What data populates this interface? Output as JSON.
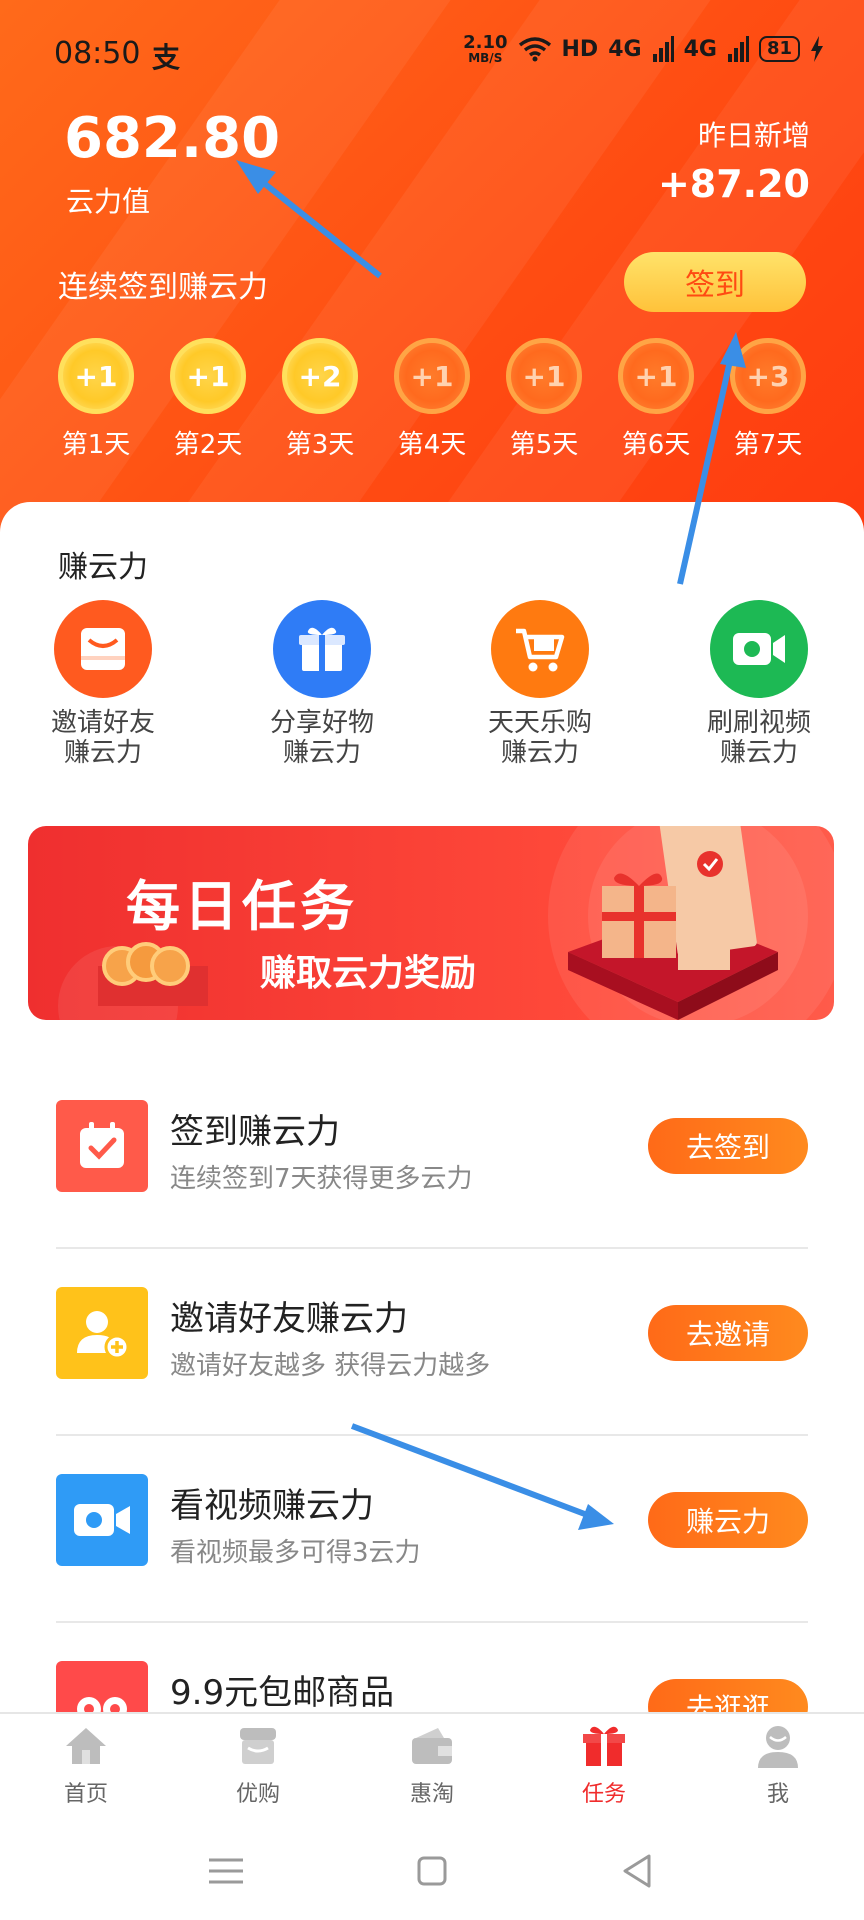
{
  "status": {
    "time": "08:50",
    "app_glyph": "支",
    "net_speed": "2.10",
    "net_unit": "MB/S",
    "hd": "HD",
    "sig1": "4G",
    "sig2": "4G",
    "battery": "81"
  },
  "header": {
    "score_value": "682.80",
    "score_label": "云力值",
    "yesterday_label": "昨日新增",
    "yesterday_value": "+87.20",
    "checkin_title": "连续签到赚云力",
    "checkin_button": "签到",
    "days": [
      {
        "reward": "+1",
        "label": "第1天",
        "done": true
      },
      {
        "reward": "+1",
        "label": "第2天",
        "done": true
      },
      {
        "reward": "+2",
        "label": "第3天",
        "done": true
      },
      {
        "reward": "+1",
        "label": "第4天",
        "done": false
      },
      {
        "reward": "+1",
        "label": "第5天",
        "done": false
      },
      {
        "reward": "+1",
        "label": "第6天",
        "done": false
      },
      {
        "reward": "+3",
        "label": "第7天",
        "done": false
      }
    ]
  },
  "earn": {
    "title": "赚云力",
    "items": [
      {
        "line1": "邀请好友",
        "line2": "赚云力",
        "icon": "invite-icon",
        "color": "#ff5a1f"
      },
      {
        "line1": "分享好物",
        "line2": "赚云力",
        "icon": "gift-icon",
        "color": "#2f7cf6"
      },
      {
        "line1": "天天乐购",
        "line2": "赚云力",
        "icon": "cart-icon",
        "color": "#ff7a10"
      },
      {
        "line1": "刷刷视频",
        "line2": "赚云力",
        "icon": "video-icon",
        "color": "#1db954"
      }
    ]
  },
  "banner": {
    "title": "每日任务",
    "subtitle": "赚取云力奖励"
  },
  "tasks": [
    {
      "title": "签到赚云力",
      "desc": "连续签到7天获得更多云力",
      "button": "去签到",
      "icon": "calendar-check-icon",
      "color": "#ff5a4a"
    },
    {
      "title": "邀请好友赚云力",
      "desc": "邀请好友越多 获得云力越多",
      "button": "去邀请",
      "icon": "add-user-icon",
      "color": "#ffc21a"
    },
    {
      "title": "看视频赚云力",
      "desc": "看视频最多可得3云力",
      "button": "赚云力",
      "icon": "video-camera-icon",
      "color": "#2f9bf6"
    },
    {
      "title": "9.9元包邮商品",
      "desc": "",
      "button": "去逛逛",
      "icon": "shopping-icon",
      "color": "#ff4a4a"
    }
  ],
  "tabbar": [
    {
      "label": "首页",
      "icon": "home-icon",
      "active": false
    },
    {
      "label": "优购",
      "icon": "shop-icon",
      "active": false
    },
    {
      "label": "惠淘",
      "icon": "wallet-icon",
      "active": false
    },
    {
      "label": "任务",
      "icon": "gift-box-icon",
      "active": true
    },
    {
      "label": "我",
      "icon": "user-icon",
      "active": false
    }
  ],
  "colors": {
    "primary": "#ff5518",
    "accent": "#ffc23a",
    "tab_active": "#f02c2c",
    "annotation": "#3a8ee6"
  }
}
